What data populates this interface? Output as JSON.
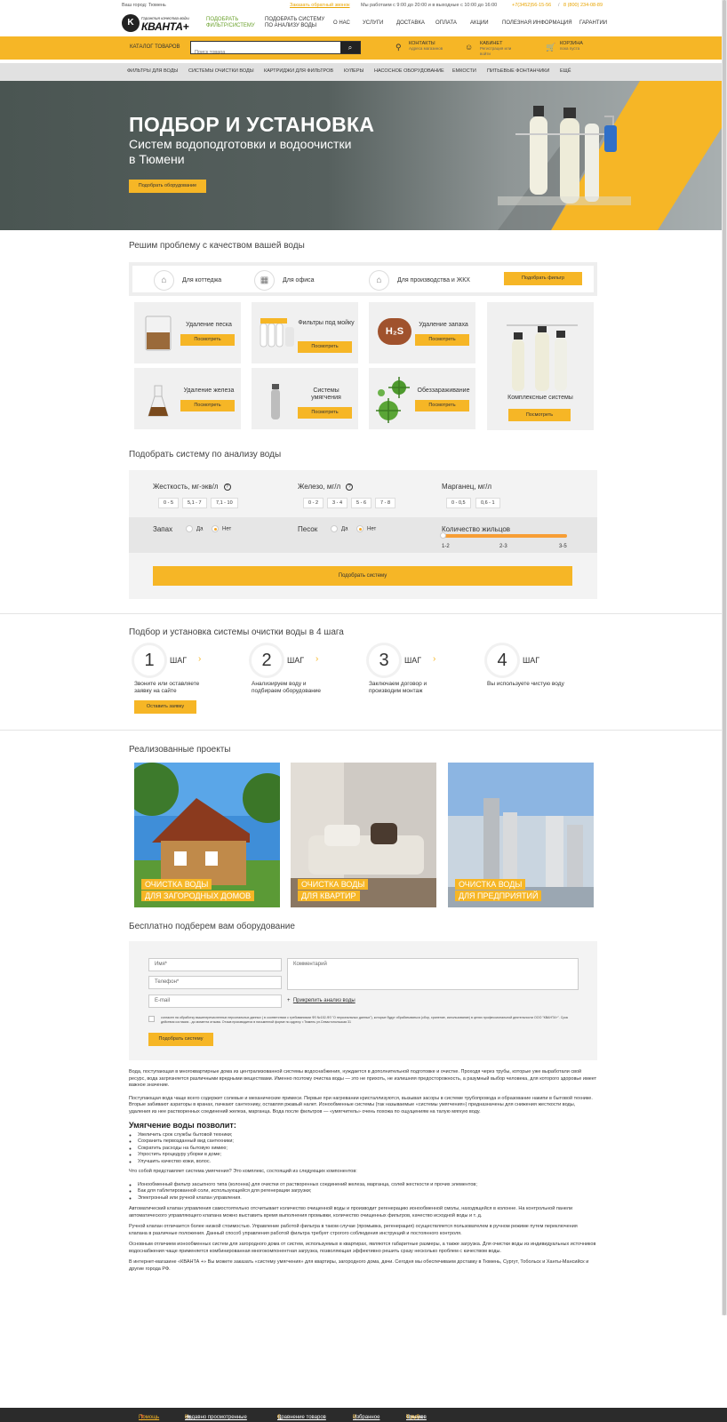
{
  "topbar": {
    "city": "Ваш город: Тюмень",
    "callback": "Заказать обратный звонок",
    "hours": "Мы работаем с 9:00 до 20:00 и в выходные с 10:00 до 16:00",
    "phone1": "+7(3452)56-15-56",
    "phone2": "8 (800) 234-08-89"
  },
  "header": {
    "logo_tagline": "Гарантия качества воды",
    "logo_name": "КВАНТА+",
    "nav": [
      {
        "label1": "ПОДОБРАТЬ",
        "label2": "ФИЛЬТР/СИСТЕМУ"
      },
      {
        "label1": "ПОДОБРАТЬ СИСТЕМУ",
        "label2": "ПО АНАЛИЗУ ВОДЫ"
      },
      {
        "label1": "О НАС"
      },
      {
        "label1": "УСЛУГИ"
      },
      {
        "label1": "ДОСТАВКА"
      },
      {
        "label1": "ОПЛАТА"
      },
      {
        "label1": "АКЦИИ"
      },
      {
        "label1": "ПОЛЕЗНАЯ ИНФОРМАЦИЯ"
      },
      {
        "label1": "ГАРАНТИИ"
      }
    ]
  },
  "ybar": {
    "catalog": "КАТАЛОГ ТОВАРОВ",
    "search_placeholder": "Поиск товара",
    "contacts": "КОНТАКТЫ",
    "contacts_sub": "Адреса магазинов",
    "cabinet": "КАБИНЕТ",
    "cabinet_sub1": "Регистрация или",
    "cabinet_sub2": "войти",
    "cart": "КОРЗИНА",
    "cart_sub": "пока пуста"
  },
  "categories": [
    "ФИЛЬТРЫ ДЛЯ ВОДЫ",
    "СИСТЕМЫ ОЧИСТКИ ВОДЫ",
    "КАРТРИДЖИ ДЛЯ ФИЛЬТРОВ",
    "КУЛЕРЫ",
    "НАСОСНОЕ ОБОРУДОВАНИЕ",
    "ЕМКОСТИ",
    "ПИТЬЕВЫЕ ФОНТАНЧИКИ",
    "ЕЩЁ"
  ],
  "hero": {
    "title": "ПОДБОР И УСТАНОВКА",
    "sub1": "Систем водоподготовки и водоочистки",
    "sub2": "в Тюмени",
    "button": "Подобрать оборудование"
  },
  "problem": {
    "heading": "Решим проблему с качеством вашей воды",
    "tabs": [
      "Для коттеджа",
      "Для офиса",
      "Для производства и ЖКХ"
    ],
    "tab_button": "Подобрать фильтр",
    "cards": [
      {
        "label": "Удаление песка",
        "button": "Посмотреть"
      },
      {
        "label": "Фильтры под мойку",
        "button": "Посмотреть"
      },
      {
        "label": "Удаление запаха",
        "button": "Посмотреть"
      },
      {
        "label": "Комплексные системы",
        "button": "Посмотреть"
      },
      {
        "label": "Удаление железа",
        "button": "Посмотреть"
      },
      {
        "label": "Системы умягчения",
        "button": "Посмотреть"
      },
      {
        "label": "Обеззараживание",
        "button": "Посмотреть"
      }
    ],
    "h2s": "H₂S"
  },
  "analysis": {
    "heading": "Подобрать систему по анализу воды",
    "hardness": "Жесткость, мг-экв/л",
    "hardness_opts": [
      "0 - 5",
      "5,1 - 7",
      "7,1 - 10"
    ],
    "iron": "Железо, мг/л",
    "iron_opts": [
      "0 - 2",
      "3 - 4",
      "5 - 6",
      "7 - 8"
    ],
    "manganese": "Марганец, мг/л",
    "manganese_opts": [
      "0 - 0,5",
      "0,6 - 1"
    ],
    "smell": "Запах",
    "sand": "Песок",
    "yes": "Да",
    "no": "Нет",
    "residents": "Количество жильцов",
    "residents_scale": [
      "1-2",
      "2-3",
      "3-5"
    ],
    "help": "?",
    "button": "Подобрать систему"
  },
  "steps": {
    "heading": "Подбор и установка системы очистки воды в 4 шага",
    "word": "ШАГ",
    "items": [
      {
        "num": "1",
        "desc": "Звоните или оставляете заявку на сайте"
      },
      {
        "num": "2",
        "desc": "Анализируем воду и подбираем оборудование"
      },
      {
        "num": "3",
        "desc": "Заключаем договор и производим монтаж"
      },
      {
        "num": "4",
        "desc": "Вы используете чистую воду"
      }
    ],
    "button": "Оставить заявку"
  },
  "projects": {
    "heading": "Реализованные проекты",
    "items": [
      {
        "l1": "ОЧИСТКА ВОДЫ",
        "l2": "ДЛЯ ЗАГОРОДНЫХ ДОМОВ"
      },
      {
        "l1": "ОЧИСТКА ВОДЫ",
        "l2": "ДЛЯ КВАРТИР"
      },
      {
        "l1": "ОЧИСТКА ВОДЫ",
        "l2": "ДЛЯ ПРЕДПРИЯТИЙ"
      }
    ]
  },
  "form": {
    "heading": "Бесплатно подберем вам оборудование",
    "name": "Имя*",
    "phone": "Телефон*",
    "email": "E-mail",
    "comment": "Комментарий",
    "attach": "Прикрепить анализ воды",
    "consent": "согласен на обработку вышеперечисленных персональных данных ( в соответствии с требованиями ФЗ №152-ФЗ \"О персональных данных\"), которые будут обрабатываться (сбор, хранение, использование) в целях профессиональной деятельности ООО \"КВАНТА+\". Срок действия согласия - до момента отзыва. Отзыв производится в письменной форме по адресу: г.Тюмень ул.Севастопольская 31",
    "button": "Подобрать систему"
  },
  "text": {
    "p1": "Вода, поступающая в многоквартирные дома из централизованной системы водоснабжения, нуждается в дополнительной подготовке и очистке. Проходя через трубы, которые уже выработали свой ресурс, вода загрязняется различными вредными веществами. Именно поэтому очистка воды — это не прихоть, не излишняя предосторожность, а разумный выбор человека, для которого здоровье имеет важное значение.",
    "p2": "Поступающая вода чаще всего содержит солевые и механические примеси. Первые при нагревании кристаллизуются, вызывая засоры в системе трубопровода и образование накипи в бытовой технике. Вторые забивают аэраторы в кранах, пачкают сантехнику, оставляя ржавый налет. Ионообменные системы (так называемые «системы умягчения») предназначены для снижения жесткости воды, удаления из нее растворенных соединений железа, марганца. Вода после фильтров — «умягчитель» очень похожа по ощущениям на талую мягкую воду.",
    "h3": "Умягчение воды позволит:",
    "list1": [
      "Увеличить срок службы бытовой техники;",
      "Сохранить первозданный вид сантехники;",
      "Сократить расходы на бытовую химию;",
      "Упростить процедуру уборки в доме;",
      "Улучшить качество кожи, волос."
    ],
    "p3": "Что собой представляет система умягчения? Это комплекс, состоящий из следующих компонентов:",
    "list2": [
      "Ионообменный фильтр засыпного типа (колонна) для очистки от растворенных соединений железа, марганца, солей жесткости и прочих элементов;",
      "Бак для таблетированной соли, использующейся для регенерации загрузки;",
      "Электронный или ручной клапан управления."
    ],
    "p4": "Автоматический клапан управления самостоятельно отсчитывает количество очищенной воды и производит регенерацию ионообменной смолы, находящейся в колонне. На контрольной панели автоматического управляющего клапана можно выставить время выполнения промывки, количество очищенных фильтров, качество исходной воды и т. д.",
    "p5": "Ручной клапан отличается более низкой стоимостью. Управление работой фильтра в таком случае (промывка, регенерация) осуществляется пользователем в ручном режиме путем переключения клапана в различные положения. Данный способ управления работой фильтра требует строгого соблюдения инструкций и постоянного контроля.",
    "p6": "Основным отличием ионообменных систем для загородного дома от систем, используемых в квартирах, являются габаритные размеры, а также загрузка. Для очистки воды из индивидуальных источников водоснабжения чаще применяется комбинированная многокомпонентная загрузка, позволяющая эффективно решить сразу несколько проблем с качеством воды.",
    "p7": "В интернет-магазине «КВАНТА +» Вы можете заказать «систему умягчения» для квартиры, загородного дома, дачи. Сегодня мы обеспечиваем доставку в Тюмень, Сургут, Тобольск и Ханты-Мансийск и другие города РФ."
  },
  "footer": {
    "help": "Помощь",
    "recent": "Недавно просмотренные",
    "recent_n": "0",
    "compare": "Сравнение товаров",
    "compare_n": "0",
    "fav": "Избранное",
    "fav_n": "0",
    "goods": "Товаров",
    "goods_n": "0",
    "sum": "Сумма",
    "sum_v": "0 руб."
  },
  "colors": {
    "accent": "#f6b626",
    "nav_green": "#6aa12b",
    "dark": "#2b2b2b"
  }
}
